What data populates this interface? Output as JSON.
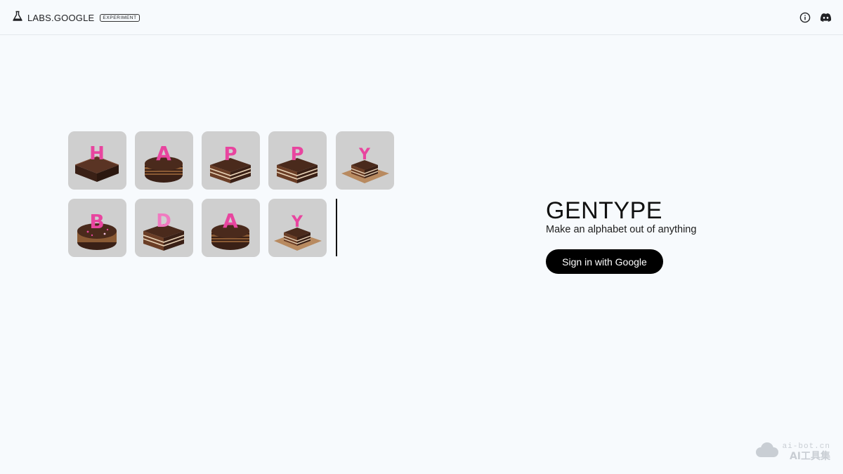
{
  "header": {
    "brand": "LABS.GOOGLE",
    "badge": "EXPERIMENT",
    "icons": [
      "flask-icon",
      "info-icon",
      "discord-icon"
    ]
  },
  "tiles": {
    "row1": [
      "H",
      "A",
      "P",
      "P",
      "Y"
    ],
    "row2": [
      "B",
      "D",
      "A",
      "Y"
    ],
    "letter_color": "#e8459f",
    "cake_color": "#4a2a1c"
  },
  "hero": {
    "title": "GENTYPE",
    "subtitle": "Make an alphabet out of anything",
    "signin_label": "Sign in with Google"
  },
  "watermark": {
    "url": "ai-bot.cn",
    "label": "AI工具集"
  }
}
